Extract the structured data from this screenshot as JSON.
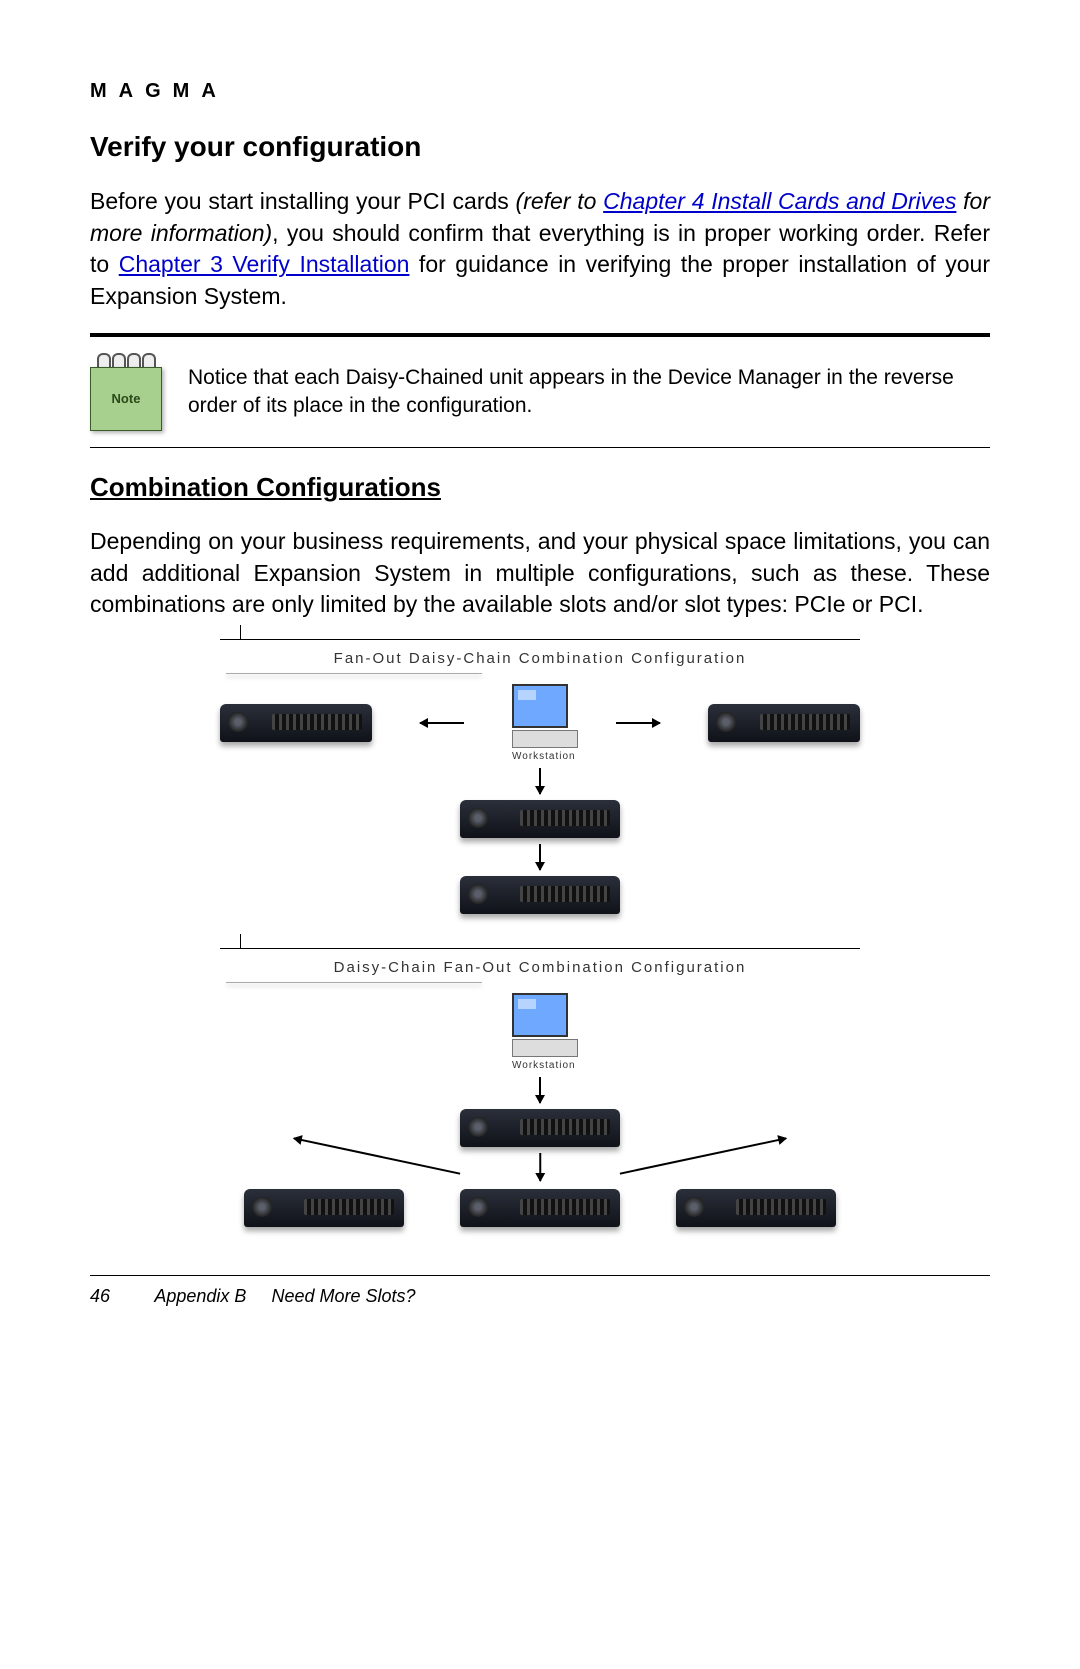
{
  "brand": "MAGMA",
  "heading_verify": "Verify your configuration",
  "para1_a": "Before you start installing your PCI cards ",
  "para1_link1_prefix_italic": "(refer to ",
  "para1_link1": "Chapter 4 Install Cards and Drives",
  "para1_b_italic": " for more information)",
  "para1_c": ", you should confirm that everything is in proper working order. Refer to ",
  "para1_link2": "Chapter 3 Verify Installation",
  "para1_d": " for guidance in verifying the proper installation of your Expansion System.",
  "note_label": "Note",
  "note_text": "Notice that each Daisy-Chained unit appears in the Device Manager in the reverse order of its place in the configuration.",
  "heading_comb": "Combination Configurations",
  "para2": "Depending on your business requirements, and your physical space limitations, you can add additional Expansion System in multiple configurations, such as these. These combinations are only limited by the available slots and/or slot types: PCIe or PCI.",
  "diagram1": {
    "title": "Fan-Out Daisy-Chain Combination Configuration",
    "workstation_label": "Workstation"
  },
  "diagram2": {
    "title": "Daisy-Chain Fan-Out Combination Configuration",
    "workstation_label": "Workstation"
  },
  "footer": {
    "page": "46",
    "appendix": "Appendix B",
    "title": "Need More Slots?"
  }
}
